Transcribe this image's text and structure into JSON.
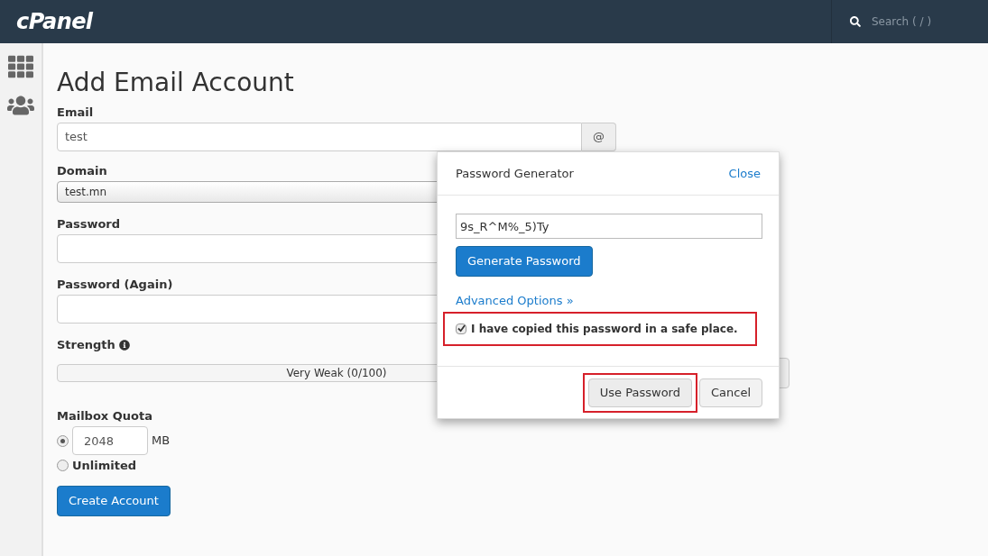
{
  "header": {
    "logo": "cPanel",
    "search": {
      "placeholder": "Search ( / )"
    }
  },
  "page": {
    "title": "Add Email Account",
    "email": {
      "label": "Email",
      "value": "test",
      "addon": "@"
    },
    "domain": {
      "label": "Domain",
      "value": "test.mn"
    },
    "password": {
      "label": "Password"
    },
    "password_again": {
      "label": "Password (Again)"
    },
    "strength": {
      "label": "Strength",
      "level": 0,
      "reading": "Very Weak (0/100)"
    },
    "quota": {
      "label": "Mailbox Quota",
      "options": [
        {
          "kind": "amount",
          "value": "2048",
          "unit": "MB",
          "selected": true
        },
        {
          "kind": "plain",
          "label": "Unlimited",
          "selected": false
        }
      ]
    },
    "submit": "Create Account"
  },
  "dialog": {
    "title": "Password Generator",
    "close": "Close",
    "password": "9s_R^M%_5)Ty",
    "generate": "Generate Password",
    "advanced": "Advanced Options »",
    "confirm": {
      "label": "I have copied this password in a safe place.",
      "checked": true,
      "highlighted": true
    },
    "buttons": [
      {
        "label": "Use Password",
        "kind": "primary",
        "highlighted": true
      },
      {
        "label": "Cancel",
        "kind": "secondary",
        "highlighted": false
      }
    ]
  }
}
